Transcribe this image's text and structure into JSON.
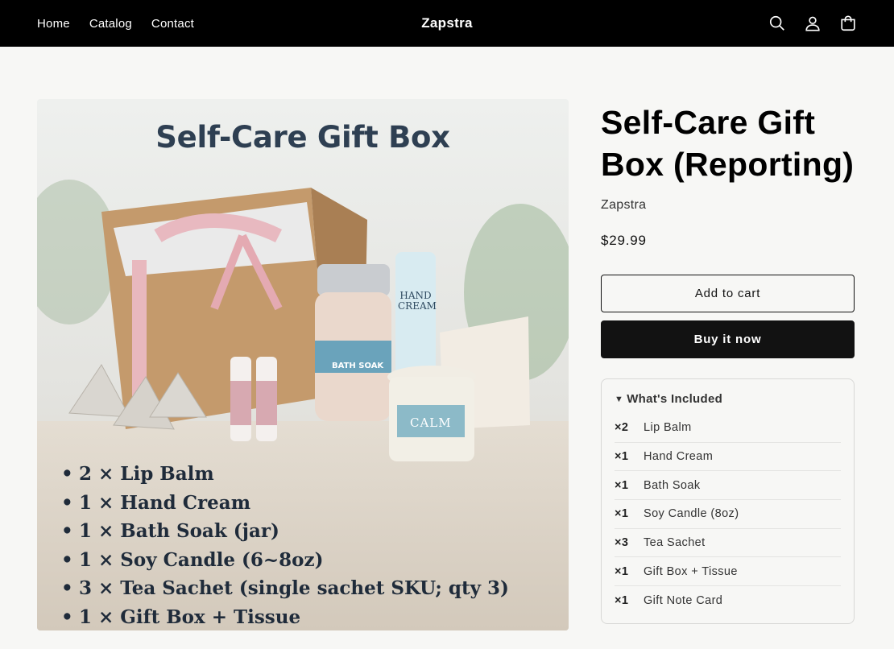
{
  "header": {
    "nav": [
      "Home",
      "Catalog",
      "Contact"
    ],
    "brand": "Zapstra",
    "icons": [
      "search-icon",
      "account-icon",
      "cart-icon"
    ],
    "background": "#000000"
  },
  "product_image": {
    "title": "Self-Care Gift Box",
    "bullets": [
      "2 × Lip Balm",
      "1 × Hand Cream",
      "1 × Bath Soak (jar)",
      "1 × Soy Candle (6~8oz)",
      "3 × Tea Sachet (single sachet SKU; qty 3)",
      "1 × Gift Box + Tissue"
    ],
    "jar_label": "BATH SOAK",
    "tube_label": "HAND CREAM",
    "candle_label": "CALM"
  },
  "product": {
    "title": "Self-Care Gift Box (Reporting)",
    "vendor": "Zapstra",
    "price": "$29.99",
    "add_to_cart": "Add to cart",
    "buy_now": "Buy it now"
  },
  "included": {
    "heading": "What's Included",
    "items": [
      {
        "qty": "×2",
        "name": "Lip Balm"
      },
      {
        "qty": "×1",
        "name": "Hand Cream"
      },
      {
        "qty": "×1",
        "name": "Bath Soak"
      },
      {
        "qty": "×1",
        "name": "Soy Candle (8oz)"
      },
      {
        "qty": "×3",
        "name": "Tea Sachet"
      },
      {
        "qty": "×1",
        "name": "Gift Box + Tissue"
      },
      {
        "qty": "×1",
        "name": "Gift Note Card"
      }
    ]
  }
}
